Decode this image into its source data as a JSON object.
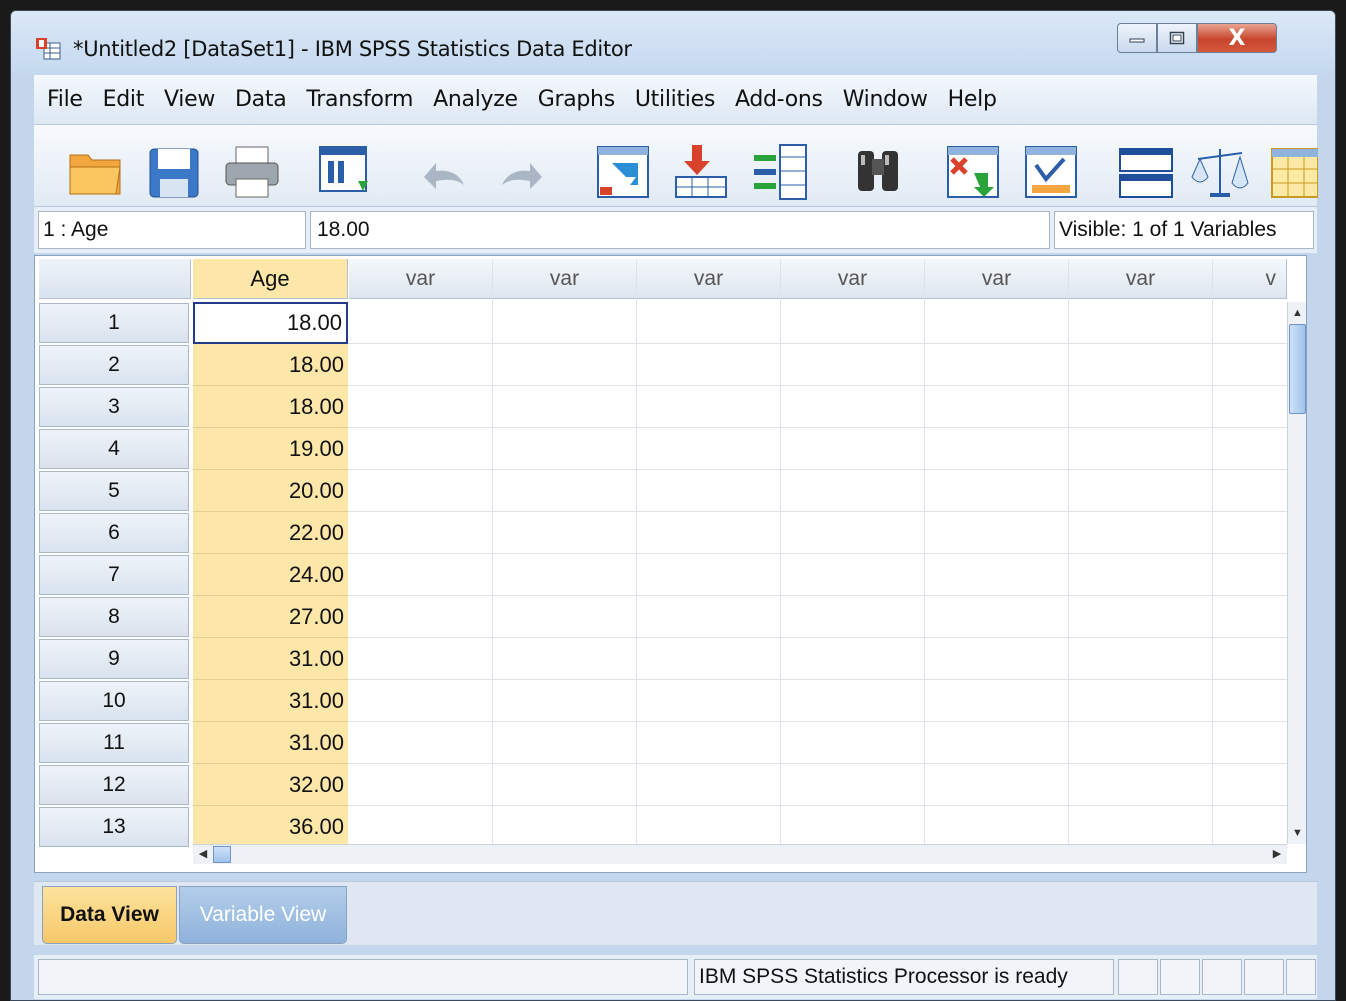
{
  "window": {
    "title": "*Untitled2 [DataSet1] - IBM SPSS Statistics Data Editor",
    "close_glyph": "X"
  },
  "menu": [
    "File",
    "Edit",
    "View",
    "Data",
    "Transform",
    "Analyze",
    "Graphs",
    "Utilities",
    "Add-ons",
    "Window",
    "Help"
  ],
  "toolbar_icons": [
    "open-folder-icon",
    "save-icon",
    "print-icon",
    "dialog-recall-icon",
    "undo-icon",
    "redo-icon",
    "goto-case-icon",
    "goto-variable-icon",
    "variables-icon",
    "find-icon",
    "insert-cases-icon",
    "insert-variable-icon",
    "split-file-icon",
    "weight-cases-icon",
    "select-cases-icon"
  ],
  "cellinfo": {
    "ref": "1 : Age",
    "value": "18.00",
    "visible": "Visible: 1 of 1 Variables"
  },
  "grid": {
    "columns": [
      "Age",
      "var",
      "var",
      "var",
      "var",
      "var",
      "var",
      "v"
    ],
    "rows": [
      {
        "n": "1",
        "age": "18.00"
      },
      {
        "n": "2",
        "age": "18.00"
      },
      {
        "n": "3",
        "age": "18.00"
      },
      {
        "n": "4",
        "age": "19.00"
      },
      {
        "n": "5",
        "age": "20.00"
      },
      {
        "n": "6",
        "age": "22.00"
      },
      {
        "n": "7",
        "age": "24.00"
      },
      {
        "n": "8",
        "age": "27.00"
      },
      {
        "n": "9",
        "age": "31.00"
      },
      {
        "n": "10",
        "age": "31.00"
      },
      {
        "n": "11",
        "age": "31.00"
      },
      {
        "n": "12",
        "age": "32.00"
      },
      {
        "n": "13",
        "age": "36.00"
      }
    ]
  },
  "tabs": {
    "data_view": "Data View",
    "variable_view": "Variable View"
  },
  "status": {
    "message": "IBM SPSS Statistics Processor is ready"
  },
  "colors": {
    "selected_column": "#fce6a8",
    "active_tab": "#f6c869",
    "inactive_tab": "#8fb3dc"
  }
}
